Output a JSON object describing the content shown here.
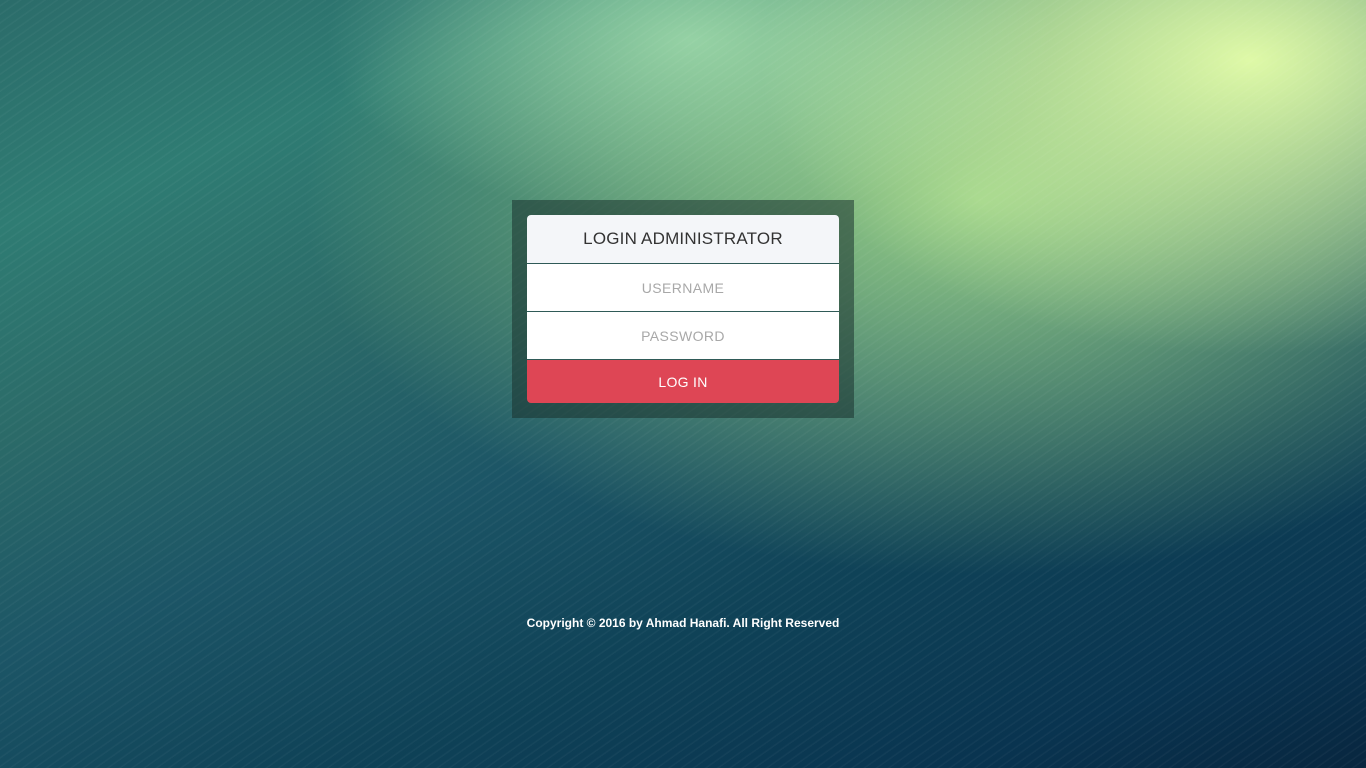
{
  "login": {
    "title": "LOGIN ADMINISTRATOR",
    "username_placeholder": "USERNAME",
    "username_value": "",
    "password_placeholder": "PASSWORD",
    "password_value": "",
    "button_label": "LOG IN"
  },
  "footer": {
    "copyright": "Copyright © 2016 by Ahmad Hanafi. All Right Reserved"
  },
  "colors": {
    "button": "#de4655",
    "header_bg": "#f4f6f9",
    "panel": "rgba(25,50,45,0.55)"
  }
}
